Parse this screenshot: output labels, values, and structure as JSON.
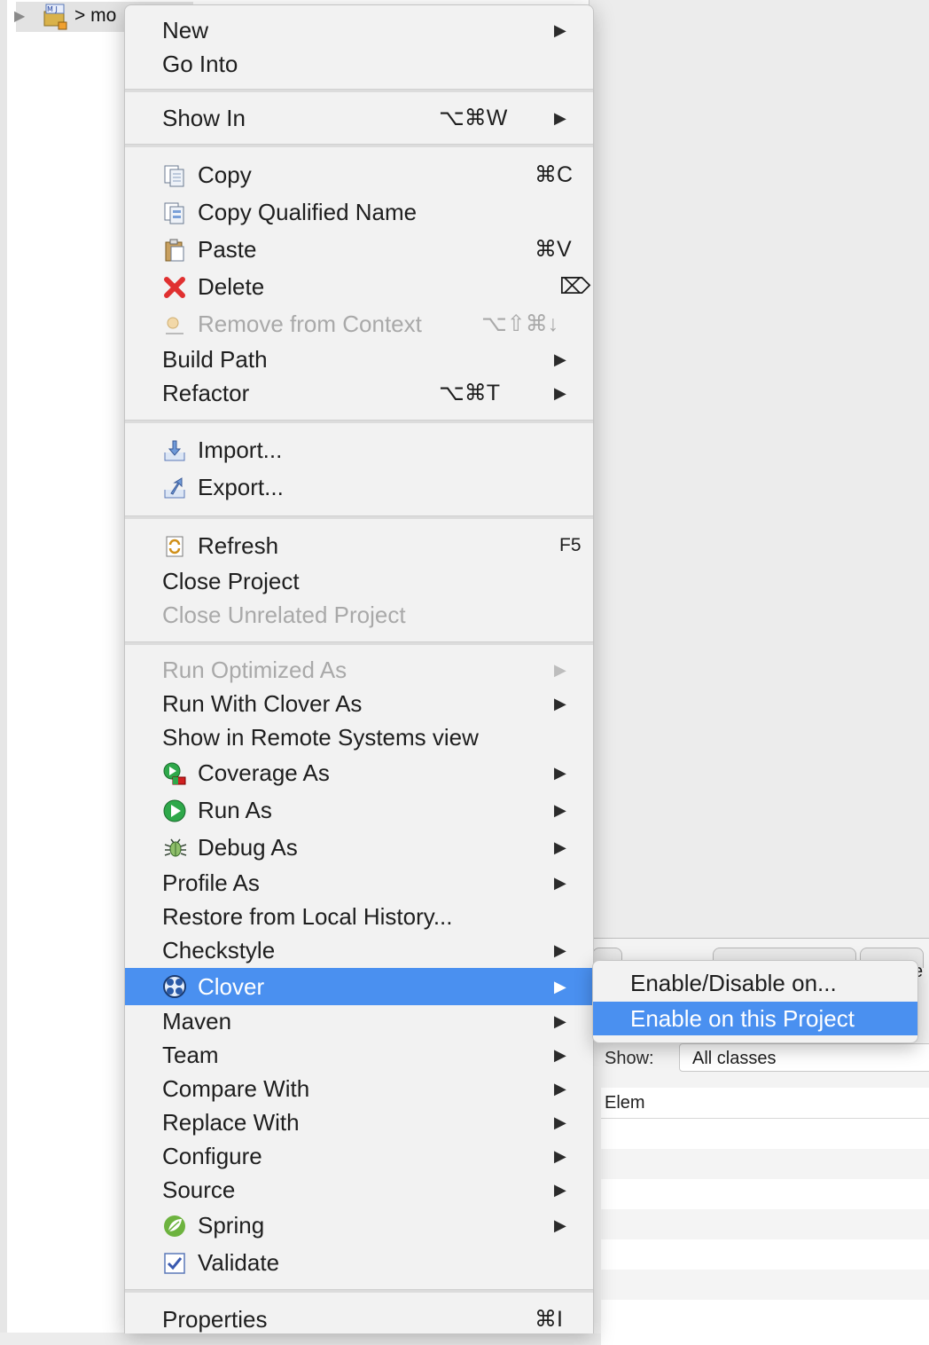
{
  "tree": {
    "project_label": "> mo"
  },
  "context_menu": {
    "items": [
      {
        "label": "New",
        "arrow": "▶"
      },
      {
        "label": "Go Into"
      },
      {
        "label": "Show In",
        "shortcut": "⌥⌘W",
        "arrow": "▶"
      },
      {
        "label": "Copy",
        "shortcut": "⌘C",
        "icon": "copy-icon"
      },
      {
        "label": "Copy Qualified Name",
        "icon": "copy-qualified-name-icon"
      },
      {
        "label": "Paste",
        "shortcut": "⌘V",
        "icon": "paste-icon"
      },
      {
        "label": "Delete",
        "shortcut": "⌦",
        "icon": "delete-icon"
      },
      {
        "label": "Remove from Context",
        "shortcut": "⌥⇧⌘↓",
        "icon": "remove-context-icon",
        "disabled": true
      },
      {
        "label": "Build Path",
        "arrow": "▶"
      },
      {
        "label": "Refactor",
        "shortcut": "⌥⌘T",
        "arrow": "▶"
      },
      {
        "label": "Import...",
        "icon": "import-icon"
      },
      {
        "label": "Export...",
        "icon": "export-icon"
      },
      {
        "label": "Refresh",
        "shortcut": "F5",
        "icon": "refresh-icon"
      },
      {
        "label": "Close Project"
      },
      {
        "label": "Close Unrelated Project",
        "disabled": true
      },
      {
        "label": "Run Optimized As",
        "arrow": "▶",
        "disabled": true
      },
      {
        "label": "Run With Clover As",
        "arrow": "▶"
      },
      {
        "label": "Show in Remote Systems view"
      },
      {
        "label": "Coverage As",
        "arrow": "▶",
        "icon": "coverage-icon"
      },
      {
        "label": "Run As",
        "arrow": "▶",
        "icon": "run-icon"
      },
      {
        "label": "Debug As",
        "arrow": "▶",
        "icon": "debug-bug-icon"
      },
      {
        "label": "Profile As",
        "arrow": "▶"
      },
      {
        "label": "Restore from Local History..."
      },
      {
        "label": "Checkstyle",
        "arrow": "▶"
      },
      {
        "label": "Clover",
        "arrow": "▶",
        "icon": "clover-icon",
        "selected": true
      },
      {
        "label": "Maven",
        "arrow": "▶"
      },
      {
        "label": "Team",
        "arrow": "▶"
      },
      {
        "label": "Compare With",
        "arrow": "▶"
      },
      {
        "label": "Replace With",
        "arrow": "▶"
      },
      {
        "label": "Configure",
        "arrow": "▶"
      },
      {
        "label": "Source",
        "arrow": "▶"
      },
      {
        "label": "Spring",
        "arrow": "▶",
        "icon": "spring-leaf-icon"
      },
      {
        "label": "Validate",
        "icon": "validate-checkbox-icon"
      },
      {
        "label": "Properties",
        "shortcut": "⌘I"
      }
    ]
  },
  "submenu": {
    "items": [
      {
        "label": "Enable/Disable on..."
      },
      {
        "label": "Enable on this Project",
        "selected": true
      }
    ]
  },
  "bottom_panel": {
    "show_label": "Show:",
    "show_value": "All classes",
    "table_header": "Elem",
    "edge_text": "e"
  },
  "colors": {
    "selection": "#4a90f0",
    "menu_bg": "#f2f2f2",
    "disabled_text": "#a9a9a9"
  }
}
